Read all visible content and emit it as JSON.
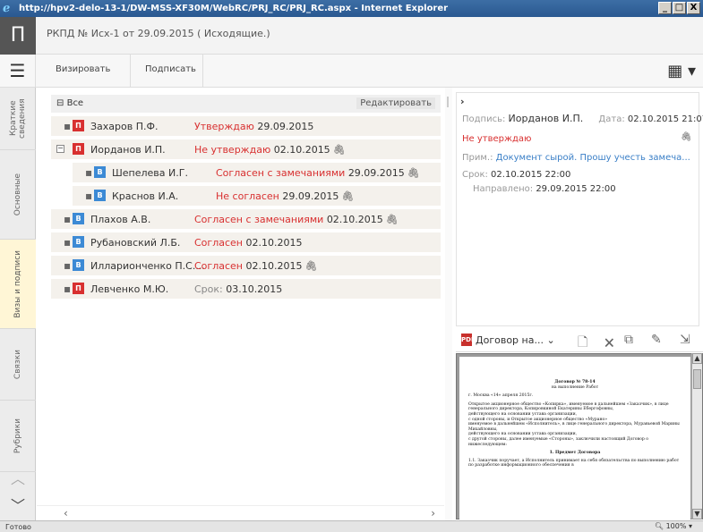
{
  "window": {
    "title": "http://hpv2-delo-13-1/DW-MSS-XF30M/WebRC/PRJ_RC/PRJ_RC.aspx - Internet Explorer",
    "controls": [
      "_",
      "□",
      "X"
    ]
  },
  "header": {
    "logo": "П",
    "doc_title": "РКПД № Исх-1 от 29.09.2015 ( Исходящие.)"
  },
  "toolbar": {
    "burger": "☰",
    "buttons": [
      "Визировать",
      "Подписать"
    ],
    "grid_icon": "▦ ▾"
  },
  "sidebar": {
    "tabs": [
      "Краткие сведения",
      "Основные",
      "Визы и подписи",
      "Связки",
      "Рубрики"
    ],
    "active_tab": "Визы и подписи",
    "up_arrow": "︿",
    "down_arrow": "﹀"
  },
  "tree": {
    "root_label": "Все",
    "edit_button": "Редактировать",
    "rows": [
      {
        "expander": "",
        "badge": "П",
        "badge_color": "#d83030",
        "name": "Захаров П.Ф.",
        "status": "Утверждаю",
        "status_color": "#d83030",
        "date": "29.09.2015",
        "clip": false
      },
      {
        "expander": "−",
        "badge": "П",
        "badge_color": "#d83030",
        "name": "Иорданов И.П.",
        "status": "Не утверждаю",
        "status_color": "#d83030",
        "date": "02.10.2015",
        "clip": true
      },
      {
        "expander": "",
        "badge": "В",
        "badge_color": "#3c8ad5",
        "name": "Шепелева И.Г.",
        "status": "Согласен с замечаниями",
        "status_color": "#d83030",
        "date": "29.09.2015",
        "clip": true
      },
      {
        "expander": "",
        "badge": "В",
        "badge_color": "#3c8ad5",
        "name": "Краснов И.А.",
        "status": "Не согласен",
        "status_color": "#d83030",
        "date": "29.09.2015",
        "clip": true
      },
      {
        "expander": "",
        "badge": "В",
        "badge_color": "#3c8ad5",
        "name": "Плахов А.В.",
        "status": "Согласен с замечаниями",
        "status_color": "#d83030",
        "date": "02.10.2015",
        "clip": true
      },
      {
        "expander": "",
        "badge": "В",
        "badge_color": "#3c8ad5",
        "name": "Рубановский Л.Б.",
        "status": "Согласен",
        "status_color": "#d83030",
        "date": "02.10.2015",
        "clip": false
      },
      {
        "expander": "",
        "badge": "В",
        "badge_color": "#3c8ad5",
        "name": "Илларионченко П.С....",
        "status": "Согласен",
        "status_color": "#d83030",
        "date": "02.10.2015",
        "clip": true
      },
      {
        "expander": "",
        "badge": "П",
        "badge_color": "#d83030",
        "name": "Левченко М.Ю.",
        "status": "Срок:",
        "status_color": "#888888",
        "date": "03.10.2015",
        "clip": false
      }
    ],
    "scroll_left": "‹",
    "scroll_right": "›"
  },
  "detail": {
    "chevron": "›",
    "sign_label": "Подпись:",
    "sign_name": "Иорданов И.П.",
    "date_label": "Дата:",
    "date_value": "02.10.2015 21:07",
    "status": "Не утверждаю",
    "note_label": "Прим.:",
    "note_text": "Документ сырой. Прошу учесть замеча...",
    "deadline_label": "Срок:",
    "deadline_value": "02.10.2015 22:00",
    "sent_label": "Направлено:",
    "sent_value": "29.09.2015 22:00",
    "clip": "🖇"
  },
  "preview": {
    "file_label": "Договор на...",
    "dropdown": "⌄",
    "icons": [
      "new-doc-icon",
      "delete-doc-icon",
      "copy-icon",
      "edit-icon",
      "export-icon"
    ],
    "page_lines": [
      "Договор № 78-14",
      "на выполнение Работ",
      "г. Москва «14» апреля 2015г.",
      "Открытое акционерное общество «Копирка», именуемое в дальнейшем «Заказчик», в лице генерального директора, Копировкиной Екатерины Ебергофовны,",
      "действующего на основании устава организации,",
      "с одной стороны, и Открытое акционерное общество «Мурано»",
      "именуемое в дальнейшем «Исполнитель», в лице генерального директора, Муравьевой Марины Михайловны,",
      "действующего на основании устава организации,",
      "с другой стороны, далее именуемые «Стороны», заключили настоящий Договор о нижеследующем:",
      "1. Предмет Договора",
      "1.1. Заказчик поручает, а Исполнитель принимает на себя обязательства по выполнению работ по разработке информационного обеспечения в"
    ]
  },
  "statusbar": {
    "ready": "Готово",
    "zoom": "100%"
  }
}
